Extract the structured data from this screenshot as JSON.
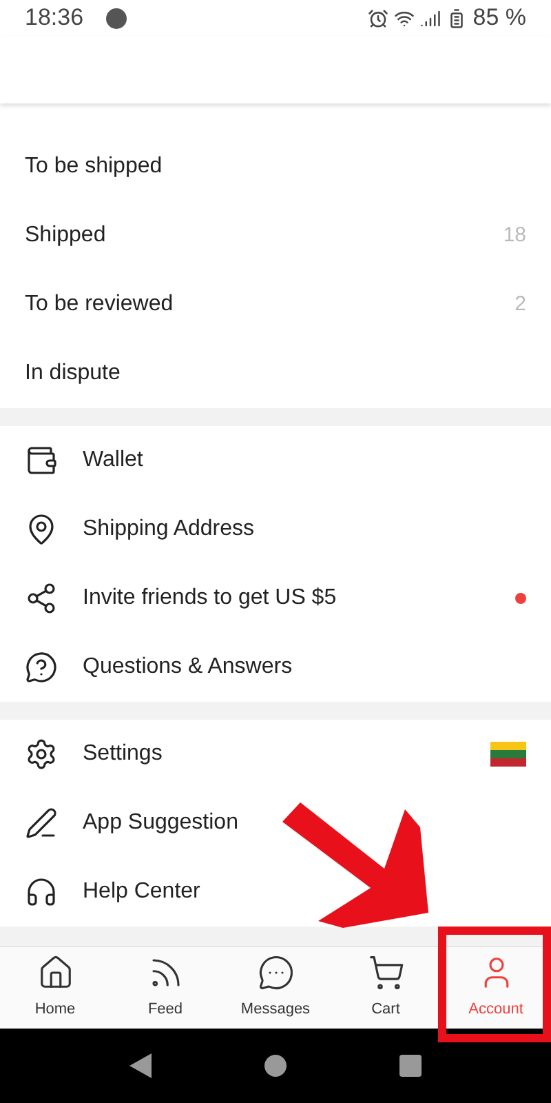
{
  "status_bar": {
    "time": "18:36",
    "battery": "85 %"
  },
  "order_rows": [
    {
      "label": "To be shipped"
    },
    {
      "label": "Shipped",
      "count": "18"
    },
    {
      "label": "To be reviewed",
      "count": "2"
    },
    {
      "label": "In dispute"
    }
  ],
  "sections": [
    [
      {
        "kind": "wallet",
        "label": "Wallet"
      },
      {
        "kind": "pin",
        "label": "Shipping Address"
      },
      {
        "kind": "share",
        "label": "Invite friends to get US $5",
        "badge": true
      },
      {
        "kind": "question",
        "label": "Questions & Answers"
      }
    ],
    [
      {
        "kind": "gear",
        "label": "Settings",
        "flag": true
      },
      {
        "kind": "pen",
        "label": "App Suggestion"
      },
      {
        "kind": "headset",
        "label": "Help Center"
      }
    ]
  ],
  "nav": [
    {
      "kind": "home",
      "label": "Home",
      "selected": false
    },
    {
      "kind": "feed",
      "label": "Feed",
      "selected": false
    },
    {
      "kind": "chat",
      "label": "Messages",
      "selected": false
    },
    {
      "kind": "cart",
      "label": "Cart",
      "selected": false
    },
    {
      "kind": "user",
      "label": "Account",
      "selected": true
    }
  ]
}
